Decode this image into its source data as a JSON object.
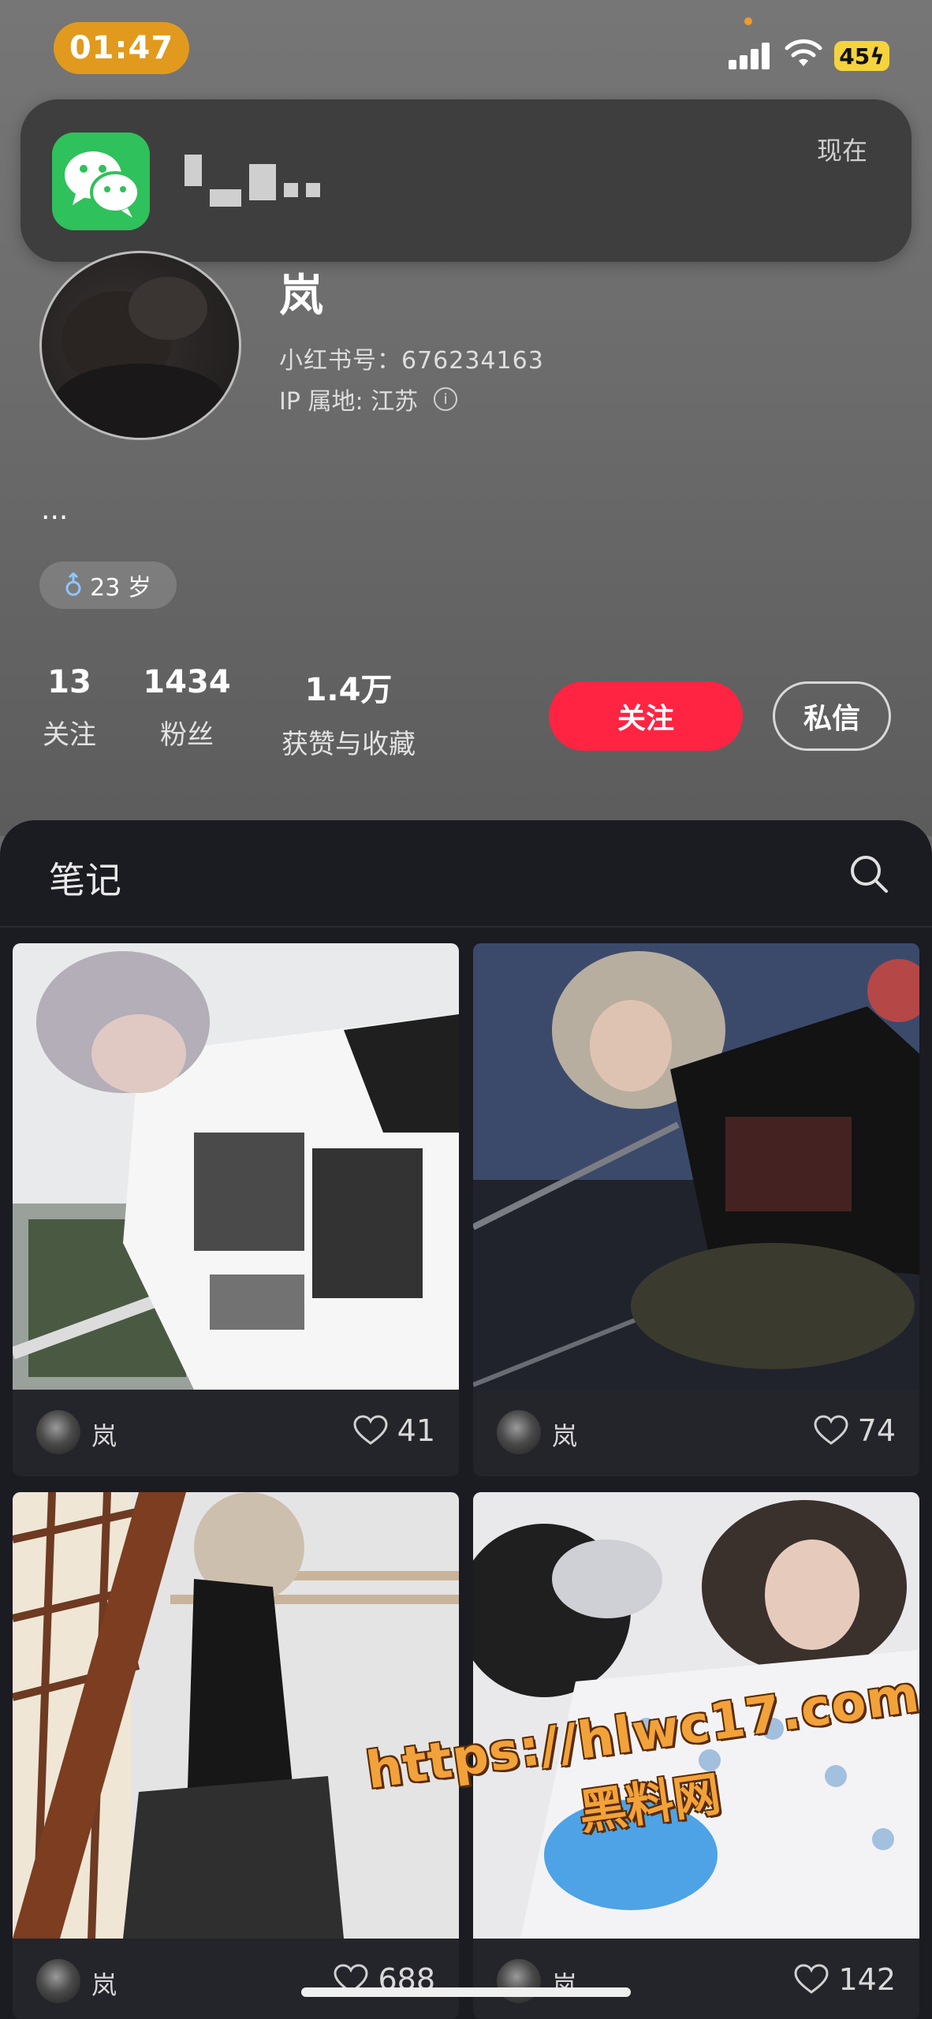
{
  "status_bar": {
    "time": "01:47",
    "battery": "45"
  },
  "notification": {
    "app_icon": "wechat-icon",
    "time": "现在"
  },
  "profile": {
    "name": "岚",
    "id_label": "小红书号：676234163",
    "ip_label": "IP 属地: 江苏",
    "bio": "...",
    "gender_icon": "male-icon",
    "age": "23 岁"
  },
  "stats": [
    {
      "value": "13",
      "label": "关注"
    },
    {
      "value": "1434",
      "label": "粉丝"
    },
    {
      "value": "1.4万",
      "label": "获赞与收藏"
    }
  ],
  "actions": {
    "follow_label": "关注",
    "message_label": "私信"
  },
  "notes": {
    "tab_label": "笔记",
    "items": [
      {
        "author": "岚",
        "likes": "41"
      },
      {
        "author": "岚",
        "likes": "74"
      },
      {
        "author": "岚",
        "likes": "688"
      },
      {
        "author": "岚",
        "likes": "142"
      }
    ]
  },
  "watermark": {
    "url": "https://hlwc17.com",
    "site": "黑料网"
  },
  "colors": {
    "accent": "#ff2442",
    "time_pill": "#e19a1d",
    "battery": "#f5d33c",
    "panel_bg": "#1b1b22"
  }
}
